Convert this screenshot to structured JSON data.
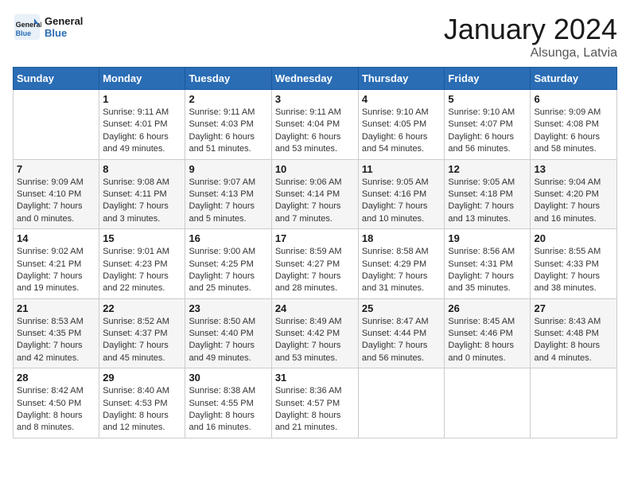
{
  "logo": {
    "text_general": "General",
    "text_blue": "Blue"
  },
  "title": "January 2024",
  "location": "Alsunga, Latvia",
  "days_of_week": [
    "Sunday",
    "Monday",
    "Tuesday",
    "Wednesday",
    "Thursday",
    "Friday",
    "Saturday"
  ],
  "weeks": [
    [
      {
        "day": "",
        "info": ""
      },
      {
        "day": "1",
        "info": "Sunrise: 9:11 AM\nSunset: 4:01 PM\nDaylight: 6 hours\nand 49 minutes."
      },
      {
        "day": "2",
        "info": "Sunrise: 9:11 AM\nSunset: 4:03 PM\nDaylight: 6 hours\nand 51 minutes."
      },
      {
        "day": "3",
        "info": "Sunrise: 9:11 AM\nSunset: 4:04 PM\nDaylight: 6 hours\nand 53 minutes."
      },
      {
        "day": "4",
        "info": "Sunrise: 9:10 AM\nSunset: 4:05 PM\nDaylight: 6 hours\nand 54 minutes."
      },
      {
        "day": "5",
        "info": "Sunrise: 9:10 AM\nSunset: 4:07 PM\nDaylight: 6 hours\nand 56 minutes."
      },
      {
        "day": "6",
        "info": "Sunrise: 9:09 AM\nSunset: 4:08 PM\nDaylight: 6 hours\nand 58 minutes."
      }
    ],
    [
      {
        "day": "7",
        "info": "Sunrise: 9:09 AM\nSunset: 4:10 PM\nDaylight: 7 hours\nand 0 minutes."
      },
      {
        "day": "8",
        "info": "Sunrise: 9:08 AM\nSunset: 4:11 PM\nDaylight: 7 hours\nand 3 minutes."
      },
      {
        "day": "9",
        "info": "Sunrise: 9:07 AM\nSunset: 4:13 PM\nDaylight: 7 hours\nand 5 minutes."
      },
      {
        "day": "10",
        "info": "Sunrise: 9:06 AM\nSunset: 4:14 PM\nDaylight: 7 hours\nand 7 minutes."
      },
      {
        "day": "11",
        "info": "Sunrise: 9:05 AM\nSunset: 4:16 PM\nDaylight: 7 hours\nand 10 minutes."
      },
      {
        "day": "12",
        "info": "Sunrise: 9:05 AM\nSunset: 4:18 PM\nDaylight: 7 hours\nand 13 minutes."
      },
      {
        "day": "13",
        "info": "Sunrise: 9:04 AM\nSunset: 4:20 PM\nDaylight: 7 hours\nand 16 minutes."
      }
    ],
    [
      {
        "day": "14",
        "info": "Sunrise: 9:02 AM\nSunset: 4:21 PM\nDaylight: 7 hours\nand 19 minutes."
      },
      {
        "day": "15",
        "info": "Sunrise: 9:01 AM\nSunset: 4:23 PM\nDaylight: 7 hours\nand 22 minutes."
      },
      {
        "day": "16",
        "info": "Sunrise: 9:00 AM\nSunset: 4:25 PM\nDaylight: 7 hours\nand 25 minutes."
      },
      {
        "day": "17",
        "info": "Sunrise: 8:59 AM\nSunset: 4:27 PM\nDaylight: 7 hours\nand 28 minutes."
      },
      {
        "day": "18",
        "info": "Sunrise: 8:58 AM\nSunset: 4:29 PM\nDaylight: 7 hours\nand 31 minutes."
      },
      {
        "day": "19",
        "info": "Sunrise: 8:56 AM\nSunset: 4:31 PM\nDaylight: 7 hours\nand 35 minutes."
      },
      {
        "day": "20",
        "info": "Sunrise: 8:55 AM\nSunset: 4:33 PM\nDaylight: 7 hours\nand 38 minutes."
      }
    ],
    [
      {
        "day": "21",
        "info": "Sunrise: 8:53 AM\nSunset: 4:35 PM\nDaylight: 7 hours\nand 42 minutes."
      },
      {
        "day": "22",
        "info": "Sunrise: 8:52 AM\nSunset: 4:37 PM\nDaylight: 7 hours\nand 45 minutes."
      },
      {
        "day": "23",
        "info": "Sunrise: 8:50 AM\nSunset: 4:40 PM\nDaylight: 7 hours\nand 49 minutes."
      },
      {
        "day": "24",
        "info": "Sunrise: 8:49 AM\nSunset: 4:42 PM\nDaylight: 7 hours\nand 53 minutes."
      },
      {
        "day": "25",
        "info": "Sunrise: 8:47 AM\nSunset: 4:44 PM\nDaylight: 7 hours\nand 56 minutes."
      },
      {
        "day": "26",
        "info": "Sunrise: 8:45 AM\nSunset: 4:46 PM\nDaylight: 8 hours\nand 0 minutes."
      },
      {
        "day": "27",
        "info": "Sunrise: 8:43 AM\nSunset: 4:48 PM\nDaylight: 8 hours\nand 4 minutes."
      }
    ],
    [
      {
        "day": "28",
        "info": "Sunrise: 8:42 AM\nSunset: 4:50 PM\nDaylight: 8 hours\nand 8 minutes."
      },
      {
        "day": "29",
        "info": "Sunrise: 8:40 AM\nSunset: 4:53 PM\nDaylight: 8 hours\nand 12 minutes."
      },
      {
        "day": "30",
        "info": "Sunrise: 8:38 AM\nSunset: 4:55 PM\nDaylight: 8 hours\nand 16 minutes."
      },
      {
        "day": "31",
        "info": "Sunrise: 8:36 AM\nSunset: 4:57 PM\nDaylight: 8 hours\nand 21 minutes."
      },
      {
        "day": "",
        "info": ""
      },
      {
        "day": "",
        "info": ""
      },
      {
        "day": "",
        "info": ""
      }
    ]
  ]
}
